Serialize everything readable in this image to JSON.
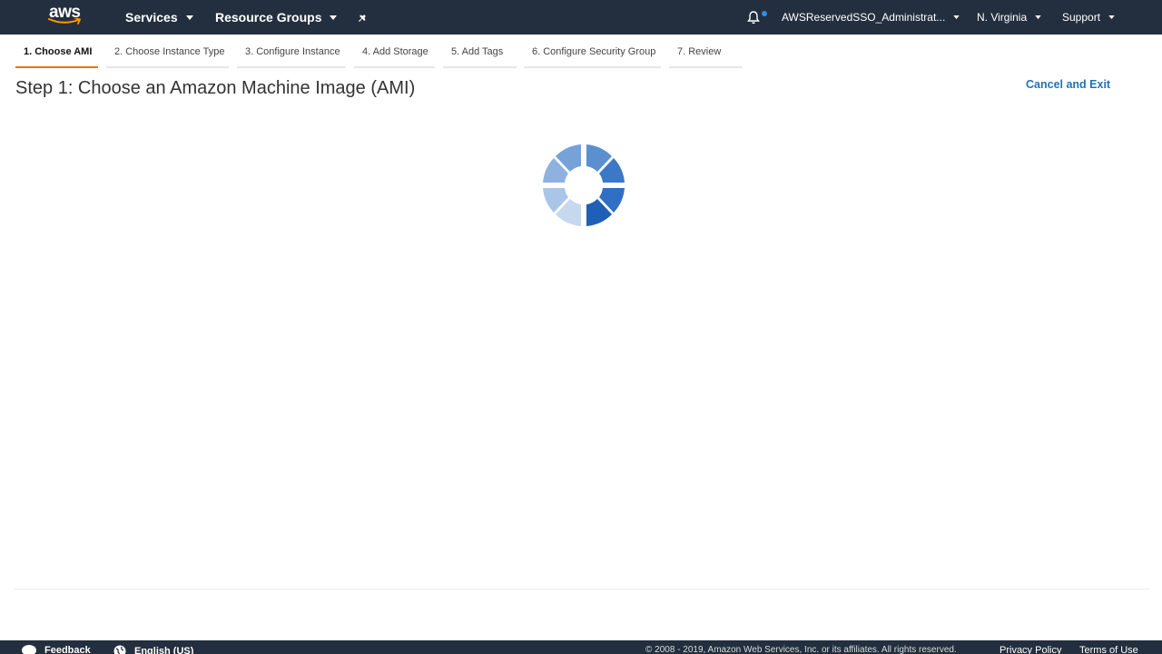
{
  "nav": {
    "logo": "aws",
    "services": "Services",
    "resource_groups": "Resource Groups",
    "pin_icon": "pin-icon",
    "bell_icon": "bell-icon",
    "account": "AWSReservedSSO_Administrat...",
    "region": "N. Virginia",
    "support": "Support"
  },
  "wizard": {
    "steps": [
      {
        "label": "1. Choose AMI",
        "active": true
      },
      {
        "label": "2. Choose Instance Type",
        "active": false
      },
      {
        "label": "3. Configure Instance",
        "active": false
      },
      {
        "label": "4. Add Storage",
        "active": false
      },
      {
        "label": "5. Add Tags",
        "active": false
      },
      {
        "label": "6. Configure Security Group",
        "active": false
      },
      {
        "label": "7. Review",
        "active": false
      }
    ],
    "title": "Step 1: Choose an Amazon Machine Image (AMI)",
    "cancel": "Cancel and Exit"
  },
  "loading_icon": "loading-spinner-icon",
  "footer": {
    "feedback": "Feedback",
    "language": "English (US)",
    "copyright": "© 2008 - 2019, Amazon Web Services, Inc. or its affiliates. All rights reserved.",
    "privacy": "Privacy Policy",
    "terms": "Terms of Use"
  },
  "colors": {
    "nav_bg": "#232f3e",
    "active_step_underline": "#ec7211",
    "link": "#1f73b7",
    "spinner": "#2f73c5"
  }
}
